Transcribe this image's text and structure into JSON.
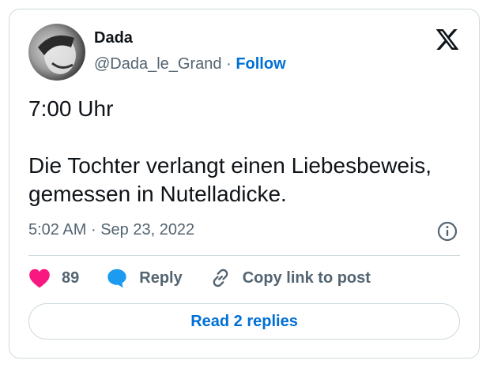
{
  "author": {
    "name": "Dada",
    "handle": "@Dada_le_Grand",
    "separator": "·",
    "follow_label": "Follow"
  },
  "tweet": {
    "line1": "7:00 Uhr",
    "line2": "Die Tochter verlangt einen Liebesbeweis, gemessen in Nutelladicke.",
    "time": "5:02 AM",
    "date": "Sep 23, 2022"
  },
  "actions": {
    "like_count": "89",
    "reply_label": "Reply",
    "copy_label": "Copy link to post"
  },
  "replies_button_label": "Read 2 replies",
  "icons": {
    "brand": "x-logo-icon",
    "info": "info-icon",
    "like": "heart-icon",
    "reply": "speech-bubble-icon",
    "copy": "link-icon"
  },
  "colors": {
    "link_blue": "#006fd6",
    "heart": "#f91880",
    "reply_bubble": "#1d9bf0",
    "secondary_text": "#536471",
    "border": "#cfd9de"
  }
}
